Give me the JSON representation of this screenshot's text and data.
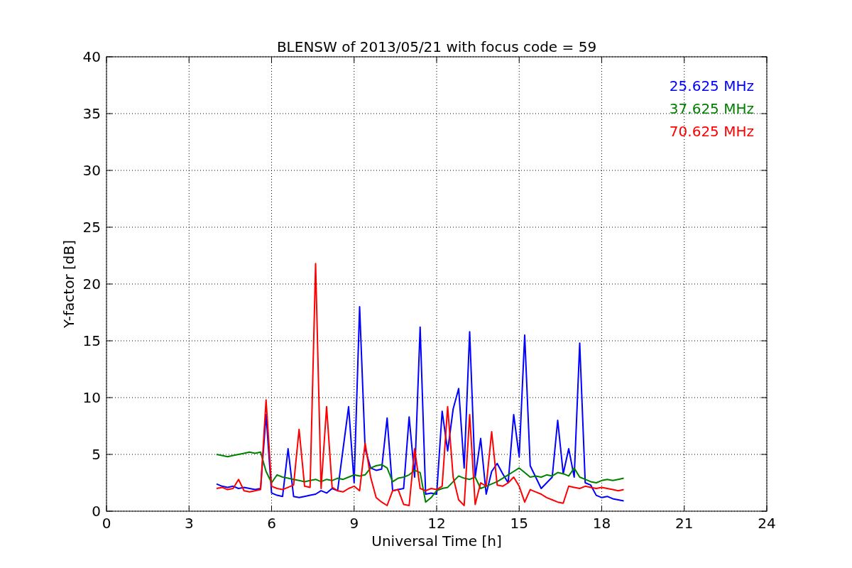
{
  "chart_data": {
    "type": "line",
    "title": "BLENSW of 2013/05/21 with focus code = 59",
    "xlabel": "Universal Time [h]",
    "ylabel": "Y-factor [dB]",
    "x": [
      4.0,
      4.2,
      4.4,
      4.6,
      4.8,
      5.0,
      5.2,
      5.4,
      5.6,
      5.8,
      6.0,
      6.2,
      6.4,
      6.6,
      6.8,
      7.0,
      7.2,
      7.4,
      7.6,
      7.8,
      8.0,
      8.2,
      8.4,
      8.6,
      8.8,
      9.0,
      9.2,
      9.4,
      9.6,
      9.8,
      10.0,
      10.2,
      10.4,
      10.6,
      10.8,
      11.0,
      11.2,
      11.4,
      11.6,
      11.8,
      12.0,
      12.2,
      12.4,
      12.6,
      12.8,
      13.0,
      13.2,
      13.4,
      13.6,
      13.8,
      14.0,
      14.2,
      14.4,
      14.6,
      14.8,
      15.0,
      15.2,
      15.4,
      15.6,
      15.8,
      16.0,
      16.2,
      16.4,
      16.6,
      16.8,
      17.0,
      17.2,
      17.4,
      17.6,
      17.8,
      18.0,
      18.2,
      18.4,
      18.6,
      18.8
    ],
    "series": [
      {
        "name": "25.625 MHz",
        "color": "#0000ff",
        "values": [
          2.4,
          2.2,
          2.1,
          2.2,
          2.0,
          2.1,
          2.0,
          1.9,
          2.0,
          8.5,
          1.6,
          1.4,
          1.3,
          5.5,
          1.3,
          1.2,
          1.3,
          1.4,
          1.5,
          1.8,
          1.6,
          2.0,
          1.8,
          5.5,
          9.2,
          2.5,
          18.0,
          5.5,
          3.8,
          3.6,
          3.7,
          8.2,
          1.8,
          1.9,
          2.0,
          8.3,
          3.0,
          16.2,
          1.5,
          1.6,
          1.5,
          8.8,
          5.3,
          9.0,
          10.8,
          3.8,
          15.8,
          3.0,
          6.4,
          1.5,
          3.5,
          4.2,
          3.3,
          2.5,
          8.5,
          4.8,
          15.5,
          4.0,
          3.0,
          2.0,
          2.5,
          3.0,
          8.0,
          3.3,
          5.5,
          3.0,
          14.8,
          2.5,
          2.3,
          1.4,
          1.2,
          1.3,
          1.1,
          1.0,
          0.9
        ]
      },
      {
        "name": "37.625 MHz",
        "color": "#008000",
        "values": [
          5.0,
          4.9,
          4.8,
          4.9,
          5.0,
          5.1,
          5.2,
          5.1,
          5.2,
          3.5,
          2.5,
          3.2,
          3.0,
          2.9,
          2.8,
          2.7,
          2.6,
          2.7,
          2.8,
          2.6,
          2.8,
          2.7,
          2.9,
          2.8,
          3.0,
          3.2,
          3.1,
          3.2,
          3.8,
          4.0,
          4.1,
          3.8,
          2.6,
          2.9,
          3.0,
          3.2,
          3.6,
          3.4,
          0.8,
          1.2,
          1.8,
          2.0,
          2.1,
          2.6,
          3.1,
          2.9,
          2.8,
          3.0,
          2.0,
          2.2,
          2.4,
          2.6,
          2.9,
          3.2,
          3.5,
          3.8,
          3.4,
          3.0,
          3.1,
          3.0,
          3.2,
          3.1,
          3.4,
          3.3,
          3.1,
          3.8,
          3.0,
          2.8,
          2.6,
          2.5,
          2.7,
          2.8,
          2.7,
          2.8,
          2.9
        ]
      },
      {
        "name": "70.625 MHz",
        "color": "#ff0000",
        "values": [
          2.0,
          2.1,
          1.9,
          2.0,
          2.8,
          1.8,
          1.7,
          1.8,
          1.9,
          9.8,
          2.2,
          2.0,
          1.9,
          2.1,
          2.3,
          7.2,
          2.2,
          2.1,
          21.8,
          2.0,
          9.2,
          2.1,
          1.8,
          1.7,
          2.0,
          2.2,
          1.8,
          6.0,
          3.0,
          1.2,
          0.8,
          0.5,
          1.8,
          1.9,
          0.6,
          0.5,
          5.5,
          2.0,
          1.8,
          2.0,
          1.9,
          2.2,
          9.2,
          3.0,
          1.0,
          0.5,
          8.5,
          0.6,
          2.5,
          2.2,
          7.0,
          2.3,
          2.2,
          2.5,
          3.0,
          2.2,
          0.8,
          1.9,
          1.7,
          1.5,
          1.2,
          1.0,
          0.8,
          0.7,
          2.2,
          2.1,
          2.0,
          2.2,
          2.1,
          2.0,
          2.1,
          2.0,
          1.9,
          1.8,
          1.9
        ]
      }
    ],
    "xlim": [
      0,
      24
    ],
    "ylim": [
      0,
      40
    ],
    "xticks": [
      0,
      3,
      6,
      9,
      12,
      15,
      18,
      21,
      24
    ],
    "yticks": [
      0,
      5,
      10,
      15,
      20,
      25,
      30,
      35,
      40
    ],
    "grid": true
  }
}
